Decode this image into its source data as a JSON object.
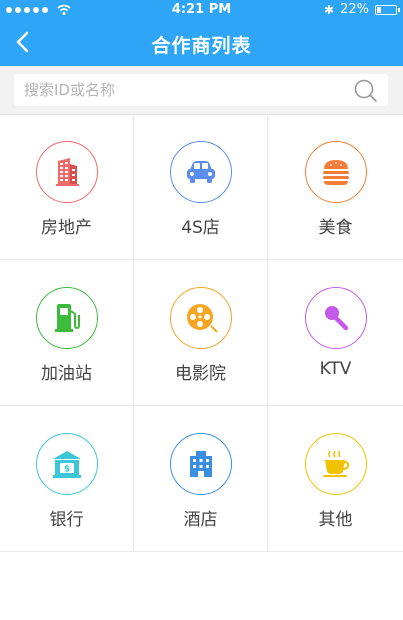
{
  "status_bar": {
    "time": "4:21 PM",
    "battery": "22%",
    "battery_level": 0.22
  },
  "header": {
    "title": "合作商列表"
  },
  "search": {
    "placeholder": "搜索ID或名称"
  },
  "categories": [
    {
      "label": "房地产",
      "icon": "building-icon",
      "color": "#f06a6a"
    },
    {
      "label": "4S店",
      "icon": "car-icon",
      "color": "#5b8def"
    },
    {
      "label": "美食",
      "icon": "burger-icon",
      "color": "#f57c3a"
    },
    {
      "label": "加油站",
      "icon": "gas-pump-icon",
      "color": "#3dbb3d"
    },
    {
      "label": "电影院",
      "icon": "film-reel-icon",
      "color": "#f5a623"
    },
    {
      "label": "KTV",
      "icon": "microphone-icon",
      "color": "#c45be8"
    },
    {
      "label": "银行",
      "icon": "bank-icon",
      "color": "#3cc7d9"
    },
    {
      "label": "酒店",
      "icon": "hotel-icon",
      "color": "#3b8fe3"
    },
    {
      "label": "其他",
      "icon": "coffee-cup-icon",
      "color": "#f2c200"
    }
  ]
}
